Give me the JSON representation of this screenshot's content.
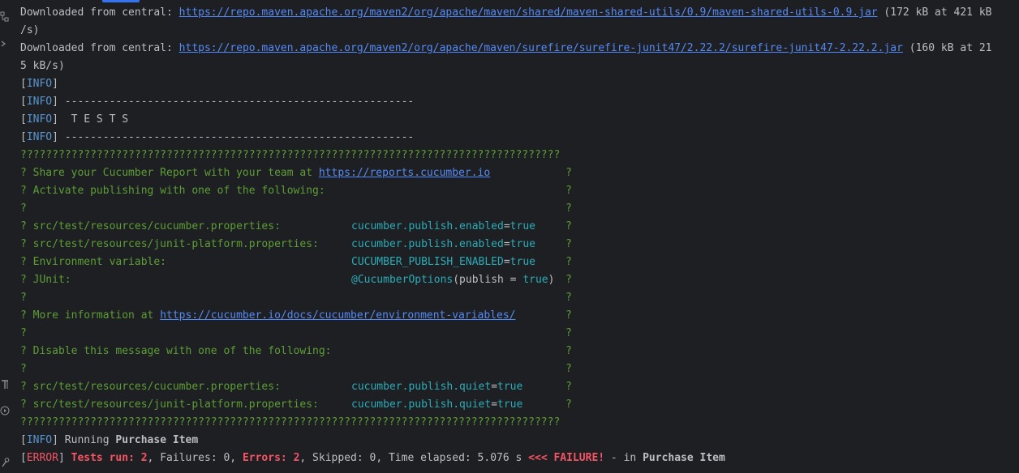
{
  "console": {
    "download1": {
      "prefix": "Downloaded from central: ",
      "url": "https://repo.maven.apache.org/maven2/org/apache/maven/shared/maven-shared-utils/0.9/maven-shared-utils-0.9.jar",
      "suffix": " (172 kB at 421 kB",
      "wrap": "/s)"
    },
    "download2": {
      "prefix": "Downloaded from central: ",
      "url": "https://repo.maven.apache.org/maven2/org/apache/maven/surefire/surefire-junit47/2.22.2/surefire-junit47-2.22.2.jar",
      "suffix": " (160 kB at 21",
      "wrap": "5 kB/s)"
    },
    "info_tag_open": "[",
    "info_tag_word": "INFO",
    "info_tag_close": "]",
    "dash_line": " -------------------------------------------------------",
    "tests_line": "  T E S T S",
    "banner_line": "?????????????????????????????????????????????????????????????????????????????????????",
    "cucumber": {
      "share_text": "? Share your Cucumber Report with your team at ",
      "share_url": "https://reports.cucumber.io",
      "activate_text": "? Activate publishing with one of the following:",
      "q": "?",
      "prop1_label": "? src/test/resources/cucumber.properties:",
      "prop1_key": "cucumber.publish.enabled",
      "prop2_label": "? src/test/resources/junit-platform.properties:",
      "prop2_key": "cucumber.publish.enabled",
      "env_label": "? Environment variable:",
      "env_key": "CUCUMBER_PUBLISH_ENABLED",
      "eq": "=",
      "true": "true",
      "junit_label": "? JUnit:",
      "junit_annotation": "@CucumberOptions",
      "junit_args_open": "(publish = ",
      "junit_args_close": ")",
      "more_text": "? More information at ",
      "more_url": "https://cucumber.io/docs/cucumber/environment-variables/",
      "disable_text": "? Disable this message with one of the following:",
      "quiet1_label": "? src/test/resources/cucumber.properties:",
      "quiet1_key": "cucumber.publish.quiet",
      "quiet2_label": "? src/test/resources/junit-platform.properties:",
      "quiet2_key": "cucumber.publish.quiet"
    },
    "running_text": " Running ",
    "running_name": "Purchase Item",
    "error_tag_open": "[",
    "error_tag_word": "ERROR",
    "error_tag_close": "]",
    "result": {
      "tests_run_label": " Tests run: ",
      "tests_run_value": "2",
      "failures_text": ", Failures: 0, ",
      "errors_label": "Errors: ",
      "errors_value": "2",
      "rest_text": ", Skipped: 0, Time elapsed: 5.076 s ",
      "failure_marker": "<<< FAILURE!",
      "in_text": " - in ",
      "in_name": "Purchase Item"
    }
  },
  "gutter_icons": [
    "structure-icon",
    "chevron-right-icon",
    "test-tube-icon",
    "run-icon",
    "settings-tool-icon"
  ],
  "colors": {
    "background": "#1e1f22",
    "text": "#bcbec4",
    "link": "#548af7",
    "info": "#5796d2",
    "error": "#f75464",
    "green": "#5c9e35",
    "teal": "#2aacb8",
    "accent": "#3574f0"
  }
}
